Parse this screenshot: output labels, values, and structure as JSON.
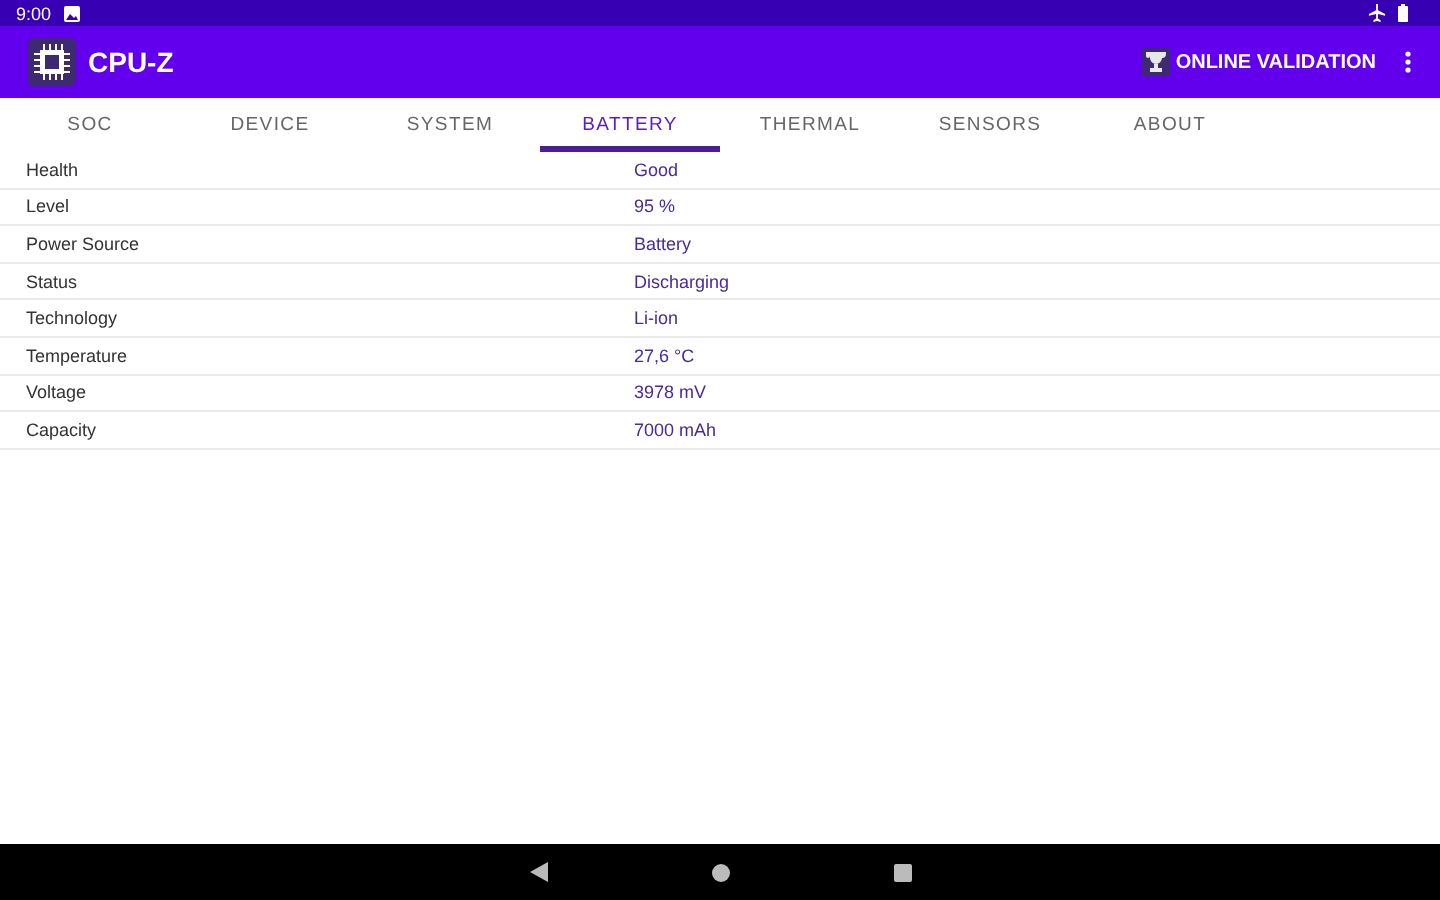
{
  "status_bar": {
    "time": "9:00"
  },
  "app_bar": {
    "title": "CPU-Z",
    "action": "ONLINE VALIDATION"
  },
  "tabs": [
    {
      "label": "SOC",
      "selected": false
    },
    {
      "label": "DEVICE",
      "selected": false
    },
    {
      "label": "SYSTEM",
      "selected": false
    },
    {
      "label": "BATTERY",
      "selected": true
    },
    {
      "label": "THERMAL",
      "selected": false
    },
    {
      "label": "SENSORS",
      "selected": false
    },
    {
      "label": "ABOUT",
      "selected": false
    }
  ],
  "rows": [
    {
      "label": "Health",
      "value": "Good"
    },
    {
      "label": "Level",
      "value": "95 %"
    },
    {
      "label": "Power Source",
      "value": "Battery"
    },
    {
      "label": "Status",
      "value": "Discharging"
    },
    {
      "label": "Technology",
      "value": "Li-ion"
    },
    {
      "label": "Temperature",
      "value": "27,6 °C"
    },
    {
      "label": "Voltage",
      "value": "3978 mV"
    },
    {
      "label": "Capacity",
      "value": "7000 mAh"
    }
  ]
}
